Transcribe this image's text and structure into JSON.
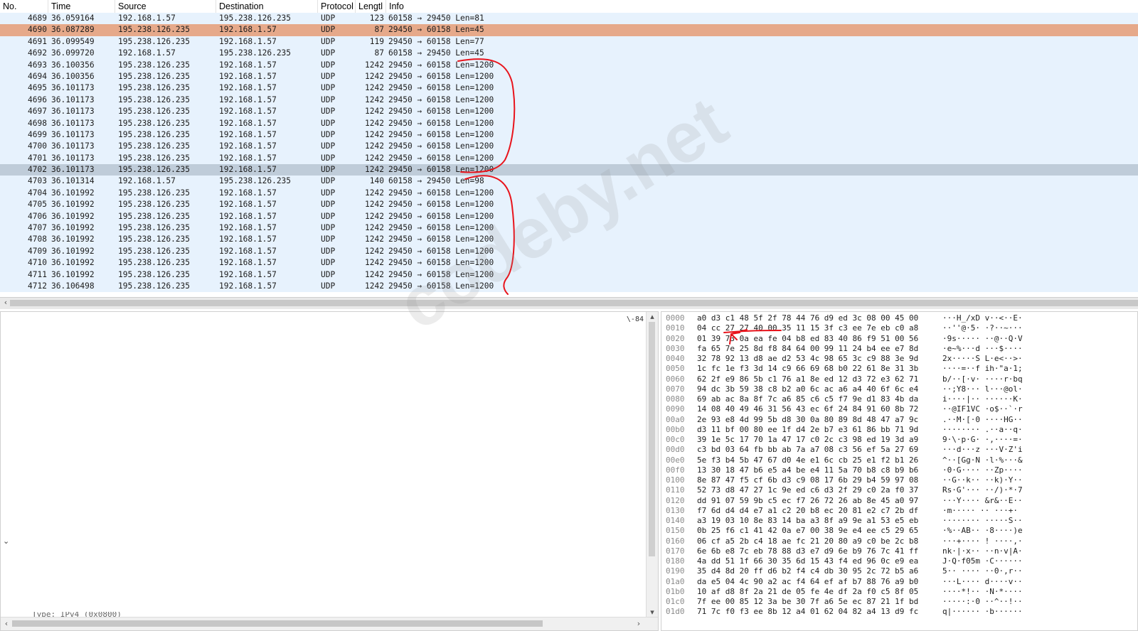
{
  "columns": {
    "no": "No.",
    "time": "Time",
    "source": "Source",
    "destination": "Destination",
    "protocol": "Protocol",
    "length": "Lengtl",
    "info": "Info"
  },
  "packets": [
    {
      "no": "4689",
      "time": "36.059164",
      "src": "192.168.1.57",
      "dst": "195.238.126.235",
      "proto": "UDP",
      "len": "123",
      "info": "60158 → 29450 Len=81"
    },
    {
      "no": "4690",
      "time": "36.087289",
      "src": "195.238.126.235",
      "dst": "192.168.1.57",
      "proto": "UDP",
      "len": "87",
      "info": "29450 → 60158 Len=45"
    },
    {
      "no": "4691",
      "time": "36.099549",
      "src": "195.238.126.235",
      "dst": "192.168.1.57",
      "proto": "UDP",
      "len": "119",
      "info": "29450 → 60158 Len=77"
    },
    {
      "no": "4692",
      "time": "36.099720",
      "src": "192.168.1.57",
      "dst": "195.238.126.235",
      "proto": "UDP",
      "len": "87",
      "info": "60158 → 29450 Len=45"
    },
    {
      "no": "4693",
      "time": "36.100356",
      "src": "195.238.126.235",
      "dst": "192.168.1.57",
      "proto": "UDP",
      "len": "1242",
      "info": "29450 → 60158 Len=1200"
    },
    {
      "no": "4694",
      "time": "36.100356",
      "src": "195.238.126.235",
      "dst": "192.168.1.57",
      "proto": "UDP",
      "len": "1242",
      "info": "29450 → 60158 Len=1200"
    },
    {
      "no": "4695",
      "time": "36.101173",
      "src": "195.238.126.235",
      "dst": "192.168.1.57",
      "proto": "UDP",
      "len": "1242",
      "info": "29450 → 60158 Len=1200"
    },
    {
      "no": "4696",
      "time": "36.101173",
      "src": "195.238.126.235",
      "dst": "192.168.1.57",
      "proto": "UDP",
      "len": "1242",
      "info": "29450 → 60158 Len=1200"
    },
    {
      "no": "4697",
      "time": "36.101173",
      "src": "195.238.126.235",
      "dst": "192.168.1.57",
      "proto": "UDP",
      "len": "1242",
      "info": "29450 → 60158 Len=1200"
    },
    {
      "no": "4698",
      "time": "36.101173",
      "src": "195.238.126.235",
      "dst": "192.168.1.57",
      "proto": "UDP",
      "len": "1242",
      "info": "29450 → 60158 Len=1200"
    },
    {
      "no": "4699",
      "time": "36.101173",
      "src": "195.238.126.235",
      "dst": "192.168.1.57",
      "proto": "UDP",
      "len": "1242",
      "info": "29450 → 60158 Len=1200"
    },
    {
      "no": "4700",
      "time": "36.101173",
      "src": "195.238.126.235",
      "dst": "192.168.1.57",
      "proto": "UDP",
      "len": "1242",
      "info": "29450 → 60158 Len=1200"
    },
    {
      "no": "4701",
      "time": "36.101173",
      "src": "195.238.126.235",
      "dst": "192.168.1.57",
      "proto": "UDP",
      "len": "1242",
      "info": "29450 → 60158 Len=1200"
    },
    {
      "no": "4702",
      "time": "36.101173",
      "src": "195.238.126.235",
      "dst": "192.168.1.57",
      "proto": "UDP",
      "len": "1242",
      "info": "29450 → 60158 Len=1200"
    },
    {
      "no": "4703",
      "time": "36.101314",
      "src": "192.168.1.57",
      "dst": "195.238.126.235",
      "proto": "UDP",
      "len": "140",
      "info": "60158 → 29450 Len=98"
    },
    {
      "no": "4704",
      "time": "36.101992",
      "src": "195.238.126.235",
      "dst": "192.168.1.57",
      "proto": "UDP",
      "len": "1242",
      "info": "29450 → 60158 Len=1200"
    },
    {
      "no": "4705",
      "time": "36.101992",
      "src": "195.238.126.235",
      "dst": "192.168.1.57",
      "proto": "UDP",
      "len": "1242",
      "info": "29450 → 60158 Len=1200"
    },
    {
      "no": "4706",
      "time": "36.101992",
      "src": "195.238.126.235",
      "dst": "192.168.1.57",
      "proto": "UDP",
      "len": "1242",
      "info": "29450 → 60158 Len=1200"
    },
    {
      "no": "4707",
      "time": "36.101992",
      "src": "195.238.126.235",
      "dst": "192.168.1.57",
      "proto": "UDP",
      "len": "1242",
      "info": "29450 → 60158 Len=1200"
    },
    {
      "no": "4708",
      "time": "36.101992",
      "src": "195.238.126.235",
      "dst": "192.168.1.57",
      "proto": "UDP",
      "len": "1242",
      "info": "29450 → 60158 Len=1200"
    },
    {
      "no": "4709",
      "time": "36.101992",
      "src": "195.238.126.235",
      "dst": "192.168.1.57",
      "proto": "UDP",
      "len": "1242",
      "info": "29450 → 60158 Len=1200"
    },
    {
      "no": "4710",
      "time": "36.101992",
      "src": "195.238.126.235",
      "dst": "192.168.1.57",
      "proto": "UDP",
      "len": "1242",
      "info": "29450 → 60158 Len=1200"
    },
    {
      "no": "4711",
      "time": "36.101992",
      "src": "195.238.126.235",
      "dst": "192.168.1.57",
      "proto": "UDP",
      "len": "1242",
      "info": "29450 → 60158 Len=1200"
    },
    {
      "no": "4712",
      "time": "36.106498",
      "src": "195.238.126.235",
      "dst": "192.168.1.57",
      "proto": "UDP",
      "len": "1242",
      "info": "29450 → 60158 Len=1200"
    }
  ],
  "selected_row_no": "4690",
  "marked_row_no": "4702",
  "detail": {
    "cut_text": "\\-84",
    "partial_text": "Type: IPv4 (0x0800)"
  },
  "bytes": [
    {
      "off": "0000",
      "hex": "a0 d3 c1 48 5f 2f 78 44  76 d9 ed 3c 08 00 45 00",
      "ascii": "···H_/xD v··<··E·"
    },
    {
      "off": "0010",
      "hex": "04 cc 27 27 40 00 35 11  15 3f c3 ee 7e eb c0 a8",
      "ascii": "··''@·5· ·?··~···"
    },
    {
      "off": "0020",
      "hex": "01 39 73 0a ea fe 04 b8  ed 83 40 86 f9 51 00 56",
      "ascii": "·9s····· ··@··Q·V"
    },
    {
      "off": "0030",
      "hex": "fa 65 7e 25 8d f8 84 64  00 99 11 24 b4 ee e7 8d",
      "ascii": "·e~%···d ···$····"
    },
    {
      "off": "0040",
      "hex": "32 78 92 13 d8 ae d2 53  4c 98 65 3c c9 88 3e 9d",
      "ascii": "2x·····S L·e<··>·"
    },
    {
      "off": "0050",
      "hex": "1c fc 1e f3 3d 14 c9 66  69 68 b0 22 61 8e 31 3b",
      "ascii": "····=··f ih·\"a·1;"
    },
    {
      "off": "0060",
      "hex": "62 2f e9 86 5b c1 76 a1  8e ed 12 d3 72 e3 62 71",
      "ascii": "b/··[·v· ····r·bq"
    },
    {
      "off": "0070",
      "hex": "94 dc 3b 59 38 c8 b2 a0  6c ac a6 a4 40 6f 6c e4",
      "ascii": "··;Y8··· l···@ol·"
    },
    {
      "off": "0080",
      "hex": "69 ab ac 8a 8f 7c a6 85  c6 c5 f7 9e d1 83 4b da",
      "ascii": "i····|·· ······K·"
    },
    {
      "off": "0090",
      "hex": "14 08 40 49 46 31 56 43  ec 6f 24 84 91 60 8b 72",
      "ascii": "··@IF1VC ·o$··`·r"
    },
    {
      "off": "00a0",
      "hex": "2e 93 e8 4d 99 5b d8 30  0a 80 89 8d 48 47 a7 9c",
      "ascii": ".··M·[·0 ····HG··"
    },
    {
      "off": "00b0",
      "hex": "d3 11 bf 00 80 ee 1f d4  2e b7 e3 61 86 bb 71 9d",
      "ascii": "········ .··a··q·"
    },
    {
      "off": "00c0",
      "hex": "39 1e 5c 17 70 1a 47 17  c0 2c c3 98 ed 19 3d a9",
      "ascii": "9·\\·p·G· ·,····=·"
    },
    {
      "off": "00d0",
      "hex": "c3 bd 03 64 fb bb ab 7a  a7 08 c3 56 ef 5a 27 69",
      "ascii": "···d···z ···V·Z'i"
    },
    {
      "off": "00e0",
      "hex": "5e f3 b4 5b 47 67 d0 4e  e1 6c cb 25 e1 f2 b1 26",
      "ascii": "^··[Gg·N ·l·%···&"
    },
    {
      "off": "00f0",
      "hex": "13 30 18 47 b6 e5 a4 be  e4 11 5a 70 b8 c8 b9 b6",
      "ascii": "·0·G···· ··Zp····"
    },
    {
      "off": "0100",
      "hex": "8e 87 47 f5 cf 6b d3 c9  08 17 6b 29 b4 59 97 08",
      "ascii": "··G··k·· ··k)·Y··"
    },
    {
      "off": "0110",
      "hex": "52 73 d8 47 27 1c 9e ed  c6 d3 2f 29 c0 2a f0 37",
      "ascii": "Rs·G'··· ··/)·*·7"
    },
    {
      "off": "0120",
      "hex": "dd 91 07 59 9b c5 ec f7  26 72 26 ab 8e 45 a0 97",
      "ascii": "···Y···· &r&··E··"
    },
    {
      "off": "0130",
      "hex": "f7 6d d4 d4 e7 a1 c2 20  b8 ec 20 81 e2 c7 2b df",
      "ascii": "·m·····  ·· ···+·"
    },
    {
      "off": "0140",
      "hex": "a3 19 03 10 8e 83 14 ba  a3 8f a9 9e a1 53 e5 eb",
      "ascii": "········ ·····S··"
    },
    {
      "off": "0150",
      "hex": "0b 25 f6 c1 41 42 0a e7  00 38 9e e4 ee c5 29 65",
      "ascii": "·%··AB·· ·8····)e"
    },
    {
      "off": "0160",
      "hex": "06 cf a5 2b c4 18 ae fc  21 20 80 a9 c0 be 2c b8",
      "ascii": "···+···· ! ····,·"
    },
    {
      "off": "0170",
      "hex": "6e 6b e8 7c eb 78 88 d3  e7 d9 6e b9 76 7c 41 ff",
      "ascii": "nk·|·x·· ··n·v|A·"
    },
    {
      "off": "0180",
      "hex": "4a dd 51 1f 66 30 35 6d  15 43 f4 ed 96 0c e9 ea",
      "ascii": "J·Q·f05m ·C······"
    },
    {
      "off": "0190",
      "hex": "35 d4 8d 20 ff d6 b2 f4  c4 db 30 95 2c 72 b5 a6",
      "ascii": "5·· ···· ··0·,r··"
    },
    {
      "off": "01a0",
      "hex": "da e5 04 4c 90 a2 ac f4  64 ef af b7 88 76 a9 b0",
      "ascii": "···L···· d····v··"
    },
    {
      "off": "01b0",
      "hex": "10 af d8 8f 2a 21 de 05  fe 4e df 2a f0 c5 8f 05",
      "ascii": "····*!·· ·N·*····"
    },
    {
      "off": "01c0",
      "hex": "7f ee 00 85 12 3a be 30  7f a6 5e ec 87 21 1f bd",
      "ascii": "·····:·0 ··^··!··"
    },
    {
      "off": "01d0",
      "hex": "71 7c f0 f3 ee 8b 12 a4  01 62 04 82 a4 13 d9 fc",
      "ascii": "q|······ ·b······"
    }
  ],
  "watermark": "codeby.net",
  "colors": {
    "row_bg": "#e7f2fd",
    "selected_bg": "#e6a98a",
    "marked_bg": "#bfccd9",
    "annotation": "#e8141c"
  }
}
